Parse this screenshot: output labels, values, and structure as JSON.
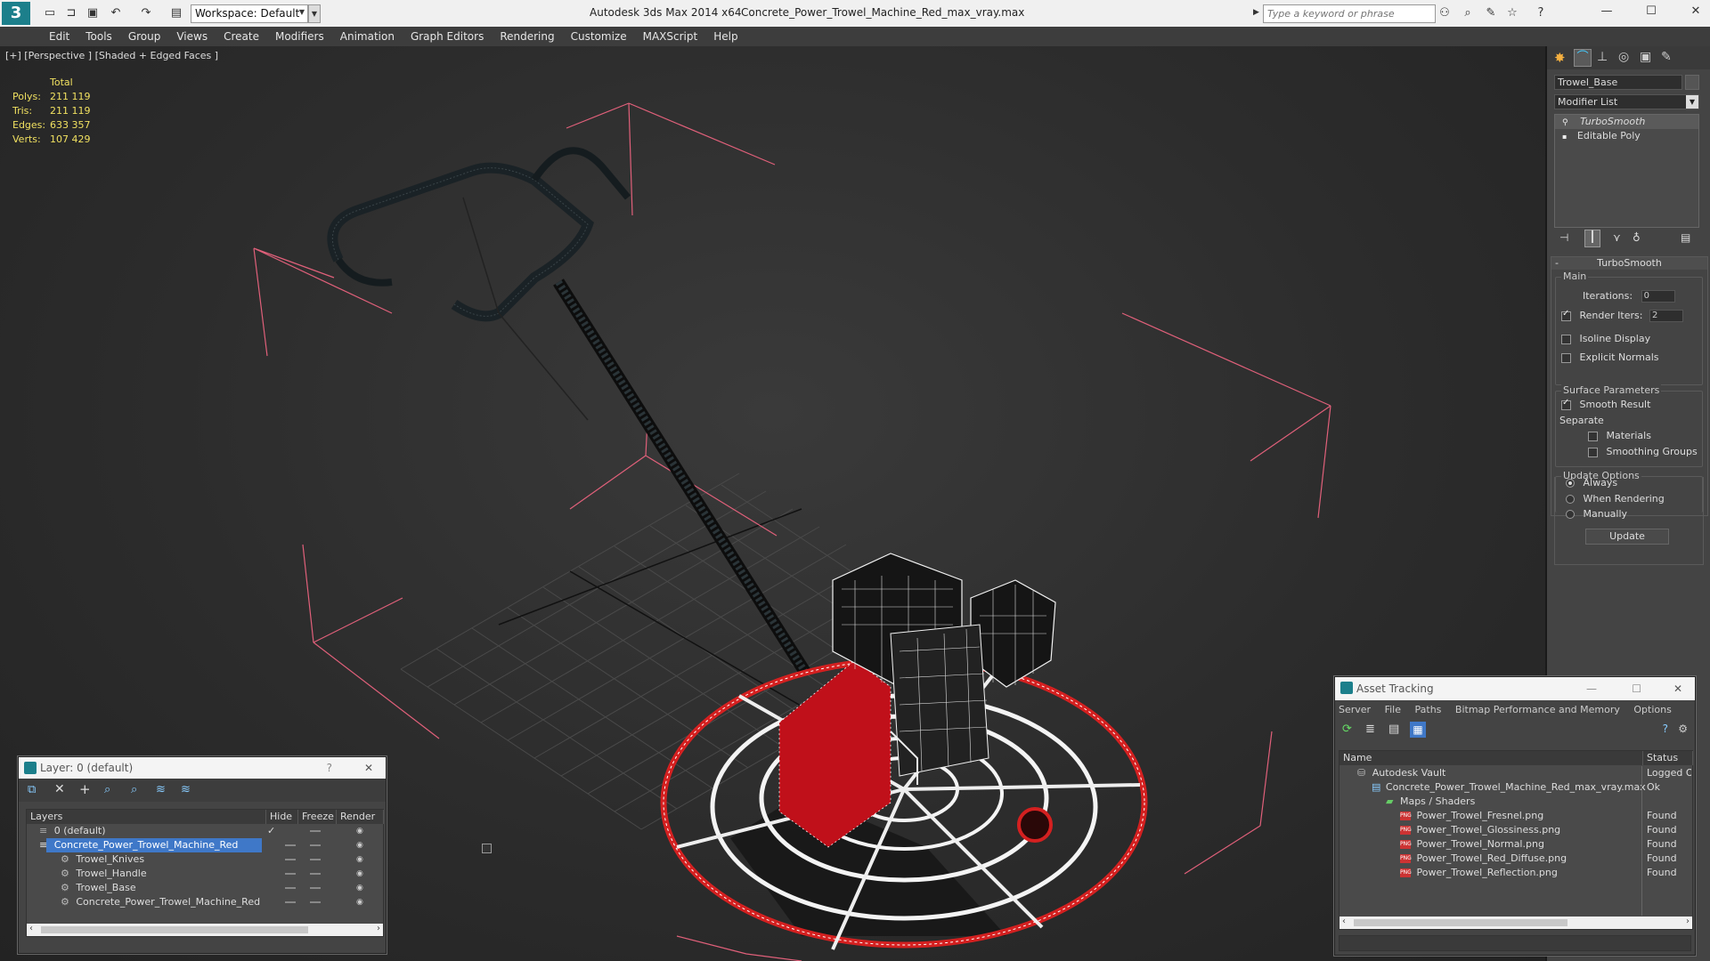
{
  "app": {
    "title": "Autodesk 3ds Max  2014 x64",
    "filename": "Concrete_Power_Trowel_Machine_Red_max_vray.max",
    "workspace": "Workspace: Default",
    "search_placeholder": "Type a keyword or phrase"
  },
  "menu": [
    "Edit",
    "Tools",
    "Group",
    "Views",
    "Create",
    "Modifiers",
    "Animation",
    "Graph Editors",
    "Rendering",
    "Customize",
    "MAXScript",
    "Help"
  ],
  "viewport": {
    "label": "[+] [Perspective ] [Shaded + Edged Faces ]",
    "stats_header": "Total",
    "stats": [
      {
        "label": "Polys:",
        "value": "211 119"
      },
      {
        "label": "Tris:",
        "value": "211 119"
      },
      {
        "label": "Edges:",
        "value": "633 357"
      },
      {
        "label": "Verts:",
        "value": "107 429"
      }
    ]
  },
  "command_panel": {
    "object_name": "Trowel_Base",
    "modifier_list": "Modifier List",
    "stack": [
      "TurboSmooth",
      "Editable Poly"
    ],
    "rollout_title": "TurboSmooth",
    "main_group": "Main",
    "iterations_label": "Iterations:",
    "iterations_value": "0",
    "render_iters_label": "Render Iters:",
    "render_iters_value": "2",
    "isoline_label": "Isoline Display",
    "explicit_label": "Explicit Normals",
    "surface_group": "Surface Parameters",
    "smooth_label": "Smooth Result",
    "separate_label": "Separate",
    "materials_label": "Materials",
    "smoothing_label": "Smoothing Groups",
    "update_group": "Update Options",
    "always_label": "Always",
    "when_rendering_label": "When Rendering",
    "manually_label": "Manually",
    "update_button": "Update"
  },
  "layer_panel": {
    "title": "Layer: 0 (default)",
    "help": "?",
    "columns": [
      "Layers",
      "Hide",
      "Freeze",
      "Render"
    ],
    "rows": [
      {
        "name": "0 (default)",
        "indent": 0
      },
      {
        "name": "Concrete_Power_Trowel_Machine_Red",
        "indent": 0
      },
      {
        "name": "Trowel_Knives",
        "indent": 1
      },
      {
        "name": "Trowel_Handle",
        "indent": 1
      },
      {
        "name": "Trowel_Base",
        "indent": 1
      },
      {
        "name": "Concrete_Power_Trowel_Machine_Red",
        "indent": 1
      }
    ]
  },
  "asset_tracking": {
    "title": "Asset Tracking",
    "menu": [
      "Server",
      "File",
      "Paths",
      "Bitmap Performance and Memory",
      "Options"
    ],
    "col_name": "Name",
    "col_status": "Status",
    "rows": [
      {
        "name": "Autodesk Vault",
        "status": "Logged O",
        "indent": 0
      },
      {
        "name": "Concrete_Power_Trowel_Machine_Red_max_vray.max",
        "status": "Ok",
        "indent": 1
      },
      {
        "name": "Maps / Shaders",
        "status": "",
        "indent": 2
      },
      {
        "name": "Power_Trowel_Fresnel.png",
        "status": "Found",
        "indent": 3
      },
      {
        "name": "Power_Trowel_Glossiness.png",
        "status": "Found",
        "indent": 3
      },
      {
        "name": "Power_Trowel_Normal.png",
        "status": "Found",
        "indent": 3
      },
      {
        "name": "Power_Trowel_Red_Diffuse.png",
        "status": "Found",
        "indent": 3
      },
      {
        "name": "Power_Trowel_Reflection.png",
        "status": "Found",
        "indent": 3
      }
    ]
  },
  "colors": {
    "accent": "#1c7f8b",
    "selection": "#3f78c8",
    "wire_red": "#e02020",
    "stats_yellow": "#f0e060",
    "bbox_pink": "#e0607a"
  }
}
